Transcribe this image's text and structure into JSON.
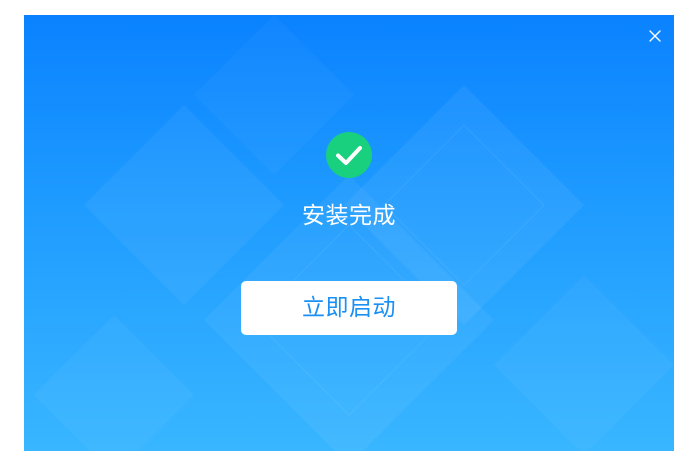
{
  "dialog": {
    "status_text": "安装完成",
    "launch_button_label": "立即启动"
  },
  "icons": {
    "close": "close-icon",
    "success": "check-circle-icon"
  },
  "colors": {
    "gradient_top": "#0a82ff",
    "gradient_bottom": "#39b6ff",
    "success_green": "#19d07e",
    "button_text": "#1a8ff5"
  }
}
